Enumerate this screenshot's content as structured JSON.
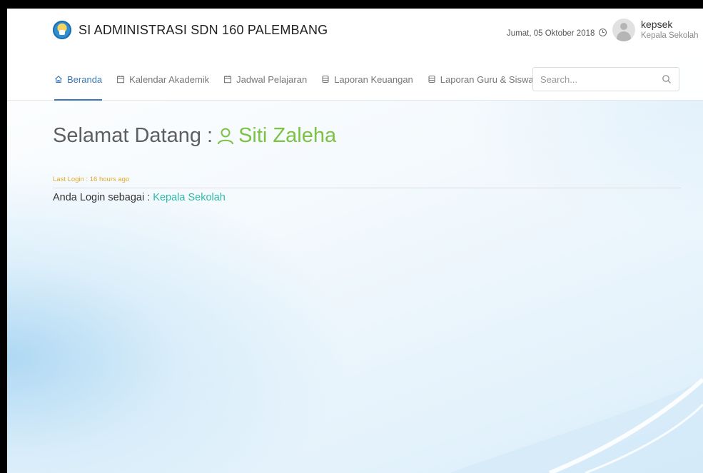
{
  "header": {
    "app_title": "SI ADMINISTRASI SDN 160 PALEMBANG",
    "date": "Jumat, 05 Oktober 2018",
    "user": {
      "name": "kepsek",
      "role": "Kepala Sekolah"
    }
  },
  "nav": {
    "items": [
      {
        "label": "Beranda",
        "icon": "home-icon",
        "active": true
      },
      {
        "label": "Kalendar Akademik",
        "icon": "calendar-icon",
        "active": false
      },
      {
        "label": "Jadwal Pelajaran",
        "icon": "calendar-icon",
        "active": false
      },
      {
        "label": "Laporan Keuangan",
        "icon": "database-icon",
        "active": false
      },
      {
        "label": "Laporan Guru & Siswa",
        "icon": "database-icon",
        "active": false
      }
    ],
    "search": {
      "placeholder": "Search..."
    }
  },
  "main": {
    "greeting_prefix": "Selamat Datang :",
    "greeting_name": "Siti Zaleha",
    "last_login": "Last Login : 16 hours ago",
    "role_prefix": "Anda Login sebagai :",
    "role_value": "Kepala Sekolah"
  },
  "colors": {
    "nav_active": "#3a77b5",
    "name_green": "#7cc243",
    "last_login_orange": "#e1a92e",
    "role_teal": "#2fb9a6"
  }
}
